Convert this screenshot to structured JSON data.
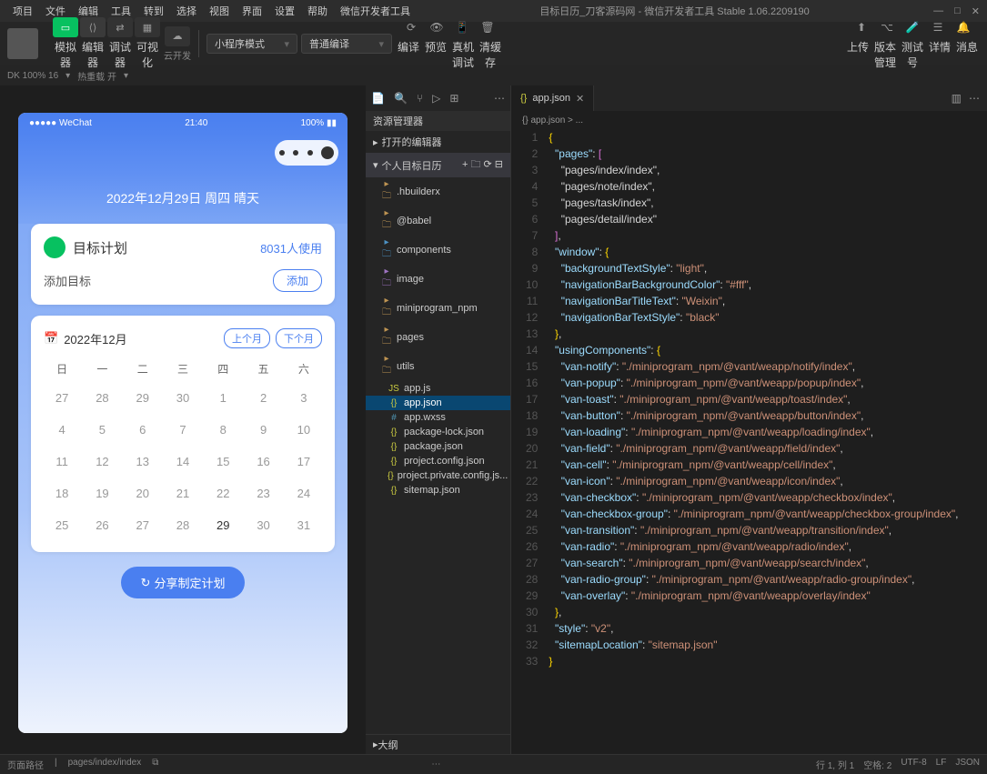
{
  "window": {
    "title": "目标日历_刀客源码网 - 微信开发者工具 Stable 1.06.2209190"
  },
  "menu": [
    "项目",
    "文件",
    "编辑",
    "工具",
    "转到",
    "选择",
    "视图",
    "界面",
    "设置",
    "帮助",
    "微信开发者工具"
  ],
  "toolbar": {
    "groups": [
      {
        "labels": [
          "模拟器",
          "编辑器",
          "调试器",
          "可视化"
        ]
      },
      {
        "labels": [
          "云开发"
        ]
      }
    ],
    "mode": "小程序模式",
    "compile": "普通编译",
    "mid": [
      "编译",
      "预览",
      "真机调试",
      "清缓存"
    ],
    "right": [
      "上传",
      "版本管理",
      "测试号",
      "详情",
      "消息"
    ]
  },
  "subbar": {
    "device": "DK 100% 16",
    "status": "热重载 开"
  },
  "simulator": {
    "status": {
      "carrier": "●●●●● WeChat",
      "signal": "📶",
      "time": "21:40",
      "battery": "100%"
    },
    "date": "2022年12月29日 周四 晴天",
    "plan": {
      "title": "目标计划",
      "usage": "8031人使用",
      "add_label": "添加目标",
      "add_btn": "添加"
    },
    "calendar": {
      "title": "2022年12月",
      "prev": "上个月",
      "next": "下个月",
      "weekdays": [
        "日",
        "一",
        "二",
        "三",
        "四",
        "五",
        "六"
      ],
      "days": [
        {
          "d": "27",
          "cur": false
        },
        {
          "d": "28",
          "cur": false
        },
        {
          "d": "29",
          "cur": false
        },
        {
          "d": "30",
          "cur": false
        },
        {
          "d": "1",
          "cur": false
        },
        {
          "d": "2",
          "cur": false
        },
        {
          "d": "3",
          "cur": false
        },
        {
          "d": "4",
          "cur": false
        },
        {
          "d": "5",
          "cur": false
        },
        {
          "d": "6",
          "cur": false
        },
        {
          "d": "7",
          "cur": false
        },
        {
          "d": "8",
          "cur": false
        },
        {
          "d": "9",
          "cur": false
        },
        {
          "d": "10",
          "cur": false
        },
        {
          "d": "11",
          "cur": false
        },
        {
          "d": "12",
          "cur": false
        },
        {
          "d": "13",
          "cur": false
        },
        {
          "d": "14",
          "cur": false
        },
        {
          "d": "15",
          "cur": false
        },
        {
          "d": "16",
          "cur": false
        },
        {
          "d": "17",
          "cur": false
        },
        {
          "d": "18",
          "cur": false
        },
        {
          "d": "19",
          "cur": false
        },
        {
          "d": "20",
          "cur": false
        },
        {
          "d": "21",
          "cur": false
        },
        {
          "d": "22",
          "cur": false
        },
        {
          "d": "23",
          "cur": false
        },
        {
          "d": "24",
          "cur": false
        },
        {
          "d": "25",
          "cur": false
        },
        {
          "d": "26",
          "cur": false
        },
        {
          "d": "27",
          "cur": false
        },
        {
          "d": "28",
          "cur": false
        },
        {
          "d": "29",
          "cur": true
        },
        {
          "d": "30",
          "cur": false
        },
        {
          "d": "31",
          "cur": false
        }
      ]
    },
    "share": "分享制定计划"
  },
  "explorer": {
    "title": "资源管理器",
    "open_editors": "打开的编辑器",
    "project": "个人目标日历",
    "tree": [
      {
        "name": ".hbuilderx",
        "type": "folder"
      },
      {
        "name": "@babel",
        "type": "folder"
      },
      {
        "name": "components",
        "type": "folder",
        "ico": "f-ts"
      },
      {
        "name": "image",
        "type": "folder",
        "ico": "f-img"
      },
      {
        "name": "miniprogram_npm",
        "type": "folder",
        "ico": "f-fold"
      },
      {
        "name": "pages",
        "type": "folder",
        "ico": "f-fold"
      },
      {
        "name": "utils",
        "type": "folder",
        "ico": "f-fold"
      },
      {
        "name": "app.js",
        "type": "file",
        "ico": "f-js"
      },
      {
        "name": "app.json",
        "type": "file",
        "ico": "f-json",
        "active": true
      },
      {
        "name": "app.wxss",
        "type": "file",
        "ico": "f-css"
      },
      {
        "name": "package-lock.json",
        "type": "file",
        "ico": "f-json"
      },
      {
        "name": "package.json",
        "type": "file",
        "ico": "f-json"
      },
      {
        "name": "project.config.json",
        "type": "file",
        "ico": "f-json"
      },
      {
        "name": "project.private.config.js...",
        "type": "file",
        "ico": "f-json"
      },
      {
        "name": "sitemap.json",
        "type": "file",
        "ico": "f-json"
      }
    ],
    "outline": "大纲"
  },
  "editor": {
    "tab": "app.json",
    "breadcrumb": "{} app.json > ...",
    "lines": [
      "{",
      "  \"pages\": [",
      "    \"pages/index/index\",",
      "    \"pages/note/index\",",
      "    \"pages/task/index\",",
      "    \"pages/detail/index\"",
      "  ],",
      "  \"window\": {",
      "    \"backgroundTextStyle\": \"light\",",
      "    \"navigationBarBackgroundColor\": \"#fff\",",
      "    \"navigationBarTitleText\": \"Weixin\",",
      "    \"navigationBarTextStyle\": \"black\"",
      "  },",
      "  \"usingComponents\": {",
      "    \"van-notify\": \"./miniprogram_npm/@vant/weapp/notify/index\",",
      "    \"van-popup\": \"./miniprogram_npm/@vant/weapp/popup/index\",",
      "    \"van-toast\": \"./miniprogram_npm/@vant/weapp/toast/index\",",
      "    \"van-button\": \"./miniprogram_npm/@vant/weapp/button/index\",",
      "    \"van-loading\": \"./miniprogram_npm/@vant/weapp/loading/index\",",
      "    \"van-field\": \"./miniprogram_npm/@vant/weapp/field/index\",",
      "    \"van-cell\": \"./miniprogram_npm/@vant/weapp/cell/index\",",
      "    \"van-icon\": \"./miniprogram_npm/@vant/weapp/icon/index\",",
      "    \"van-checkbox\": \"./miniprogram_npm/@vant/weapp/checkbox/index\",",
      "    \"van-checkbox-group\": \"./miniprogram_npm/@vant/weapp/checkbox-group/index\",",
      "    \"van-transition\": \"./miniprogram_npm/@vant/weapp/transition/index\",",
      "    \"van-radio\": \"./miniprogram_npm/@vant/weapp/radio/index\",",
      "    \"van-search\": \"./miniprogram_npm/@vant/weapp/search/index\",",
      "    \"van-radio-group\": \"./miniprogram_npm/@vant/weapp/radio-group/index\",",
      "    \"van-overlay\": \"./miniprogram_npm/@vant/weapp/overlay/index\"",
      "  },",
      "  \"style\": \"v2\",",
      "  \"sitemapLocation\": \"sitemap.json\"",
      "}"
    ]
  },
  "statusbar": {
    "left": [
      "页面路径",
      "pages/index/index"
    ],
    "right": [
      "行 1, 列 1",
      "空格: 2",
      "UTF-8",
      "LF",
      "JSON"
    ]
  }
}
